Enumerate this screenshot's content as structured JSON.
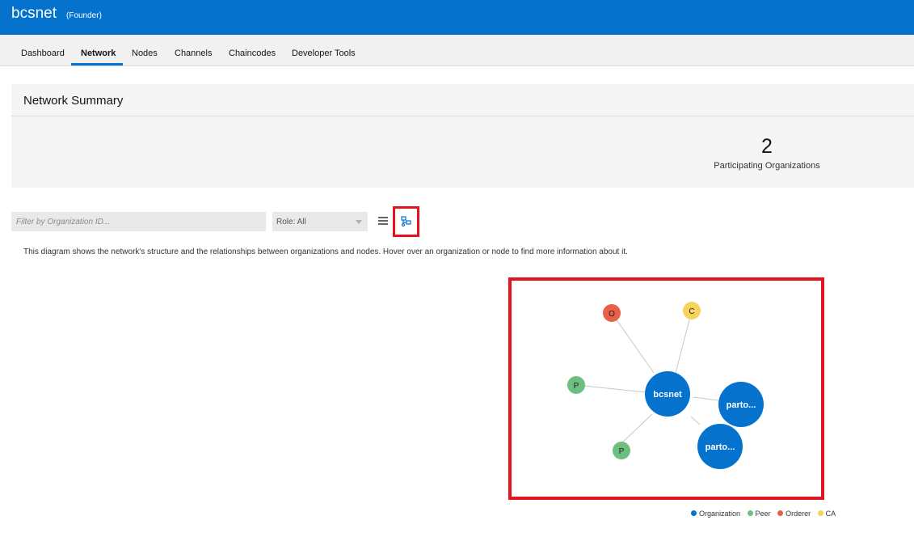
{
  "header": {
    "title": "bcsnet",
    "role": "(Founder)",
    "brand_color": "#0572ce"
  },
  "tabs": [
    {
      "label": "Dashboard"
    },
    {
      "label": "Network",
      "active": true
    },
    {
      "label": "Nodes"
    },
    {
      "label": "Channels"
    },
    {
      "label": "Chaincodes"
    },
    {
      "label": "Developer Tools"
    }
  ],
  "summary": {
    "title": "Network Summary",
    "participating_count": "2",
    "participating_label": "Participating Organizations"
  },
  "filters": {
    "org_placeholder": "Filter by Organization ID...",
    "role_value": "Role: All",
    "list_view_icon": "list-icon",
    "diagram_view_icon": "network-diagram-icon"
  },
  "description": "This diagram shows the network's structure and the relationships between organizations and nodes. Hover over an organization or node to find more information about it.",
  "diagram": {
    "nodes": [
      {
        "id": "bcsnet",
        "label": "bcsnet",
        "type": "organization"
      },
      {
        "id": "org2",
        "label": "parto...",
        "type": "organization"
      },
      {
        "id": "org3",
        "label": "parto...",
        "type": "organization"
      },
      {
        "id": "orderer",
        "label": "O",
        "type": "orderer"
      },
      {
        "id": "ca",
        "label": "C",
        "type": "ca"
      },
      {
        "id": "peer1",
        "label": "P",
        "type": "peer"
      },
      {
        "id": "peer2",
        "label": "P",
        "type": "peer"
      }
    ],
    "colors": {
      "organization": "#0572ce",
      "peer": "#6dbf80",
      "orderer": "#e8604a",
      "ca": "#f5d45e"
    }
  },
  "legend": [
    {
      "label": "Organization",
      "color": "#0572ce"
    },
    {
      "label": "Peer",
      "color": "#6dbf80"
    },
    {
      "label": "Orderer",
      "color": "#e8604a"
    },
    {
      "label": "CA",
      "color": "#f5d45e"
    }
  ]
}
